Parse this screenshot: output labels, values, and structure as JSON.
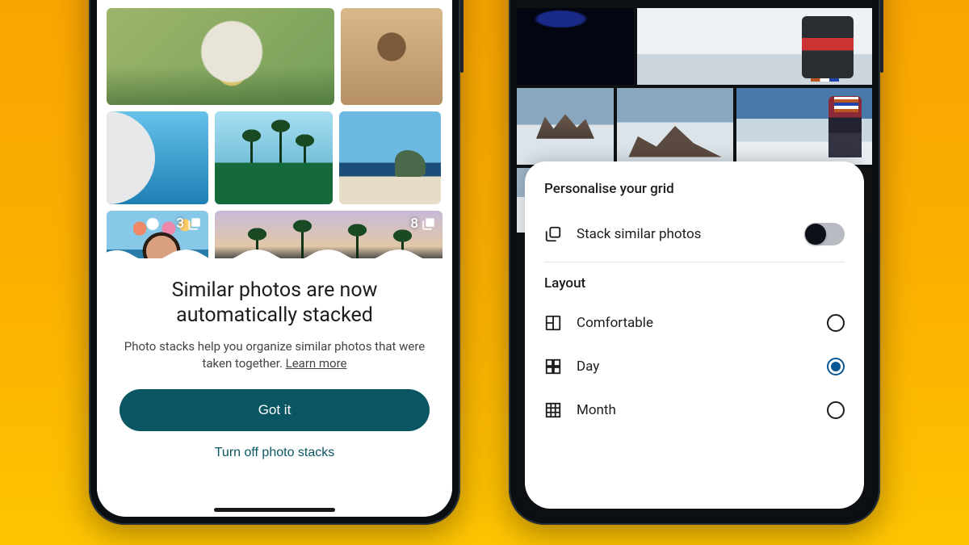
{
  "phone_left": {
    "stack_badges": {
      "photo_f": "3",
      "photo_g": "8"
    },
    "sheet": {
      "title_line1": "Similar photos are now",
      "title_line2": "automatically stacked",
      "body": "Photo stacks help you organize similar photos that were taken together. ",
      "learn_more": "Learn more",
      "primary_button": "Got it",
      "secondary_button": "Turn off photo stacks"
    }
  },
  "phone_right": {
    "sheet_title": "Personalise your grid",
    "stack_toggle": {
      "label": "Stack similar photos",
      "on": true
    },
    "layout_section_title": "Layout",
    "layout_options": [
      {
        "key": "comfortable",
        "label": "Comfortable",
        "selected": false
      },
      {
        "key": "day",
        "label": "Day",
        "selected": true
      },
      {
        "key": "month",
        "label": "Month",
        "selected": false
      }
    ]
  }
}
